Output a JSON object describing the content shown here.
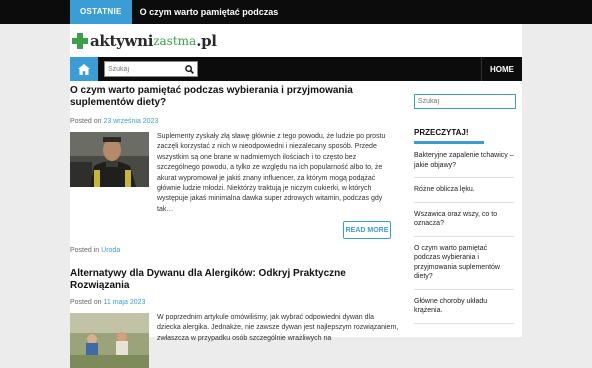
{
  "topbar": {
    "tag": "OSTATNIE",
    "ticker": "O czym warto pamiętać podczas wybierania i przyjmowania suplementów diety?"
  },
  "logo": {
    "part1": "aktywni",
    "part2": "zastma",
    "part3": ".pl"
  },
  "nav": {
    "search_placeholder": "Szukaj",
    "home_label": "HOME"
  },
  "posts": [
    {
      "title": "O czym warto pamiętać podczas wybierania i przyjmowania suplementów diety?",
      "posted_on": "Posted on",
      "date": "23 września 2023",
      "excerpt": "Suplementy zyskały złą sławę głównie z tego powodu, że ludzie po prostu zaczęli korzystać z nich w nieodpowiedni i niezalecany sposób. Przede wszystkim są one brane w nadmiernych ilościach i to często bez szczególnego powodu, a tylko ze względu na ich popularność albo to, że akurat wypromował je jakiś znany influencer, za którym mogą podążać głównie ludzie młodzi. Niektórzy traktują je niczym cukierki, w których występuje jakaś minimalna dawka super zdrowych witamin, podczas gdy tak…",
      "read_more": "READ MORE",
      "posted_in": "Posted in",
      "category": "Uroda"
    },
    {
      "title": "Alternatywy dla Dywanu dla Alergików: Odkryj Praktyczne Rozwiązania",
      "posted_on": "Posted on",
      "date": "11 maja 2023",
      "excerpt": "W poprzednim artykule omówiliśmy, jak wybrać odpowiedni dywan dla dziecka alergika. Jednakże, nie zawsze dywan jest najlepszym rozwiązaniem, zwłaszcza w przypadku osób szczególnie wrażliwych na"
    }
  ],
  "sidebar": {
    "search_placeholder": "Szukaj",
    "heading": "PRZECZYTAJ!",
    "items": [
      "Bakteryjne zapalenie tchawicy – jakie objawy?",
      "Różne oblicza lęku.",
      "Wszawica oraz wszy, co to oznacza?",
      "O czym warto pamiętać podczas wybierania i przyjmowania suplementów diety?",
      "Główne choroby układu krążenia."
    ]
  },
  "colors": {
    "accent": "#3b9dd6",
    "logo_green": "#3aa04a",
    "bar_black": "#0c0c0c"
  }
}
